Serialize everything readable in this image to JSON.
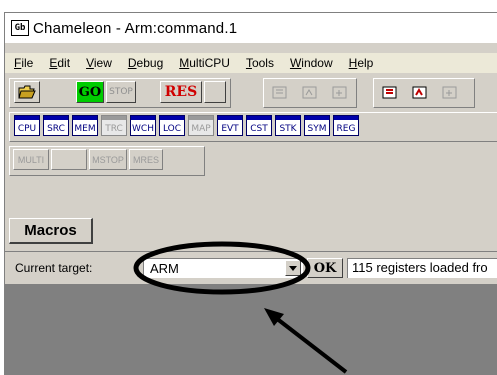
{
  "window": {
    "title": "Chameleon - Arm:command.1",
    "icon_glyph": "Gb"
  },
  "menu": [
    "File",
    "Edit",
    "View",
    "Debug",
    "MultiCPU",
    "Tools",
    "Window",
    "Help"
  ],
  "toolbar1": {
    "go_label": "GO",
    "stop_label": "STOP",
    "res_label": "RES",
    "go_color": "#00cc00",
    "res_color": "#d00000"
  },
  "toolbar2": {
    "buttons": [
      "CPU",
      "SRC",
      "MEM",
      "TRC",
      "WCH",
      "LOC",
      "MAP",
      "EVT",
      "CST",
      "STK",
      "SYM",
      "REG"
    ]
  },
  "toolbar3": {
    "multi_label": "MULTI",
    "mstop_label": "MSTOP",
    "mres_label": "MRES"
  },
  "macros": {
    "label": "Macros"
  },
  "target": {
    "label": "Current target:",
    "value": "ARM",
    "ok_label": "OK",
    "status": "115 registers loaded fro"
  },
  "colors": {
    "annotation": "#000000",
    "workspace": "#808080",
    "chrome": "#d4d0c8"
  }
}
